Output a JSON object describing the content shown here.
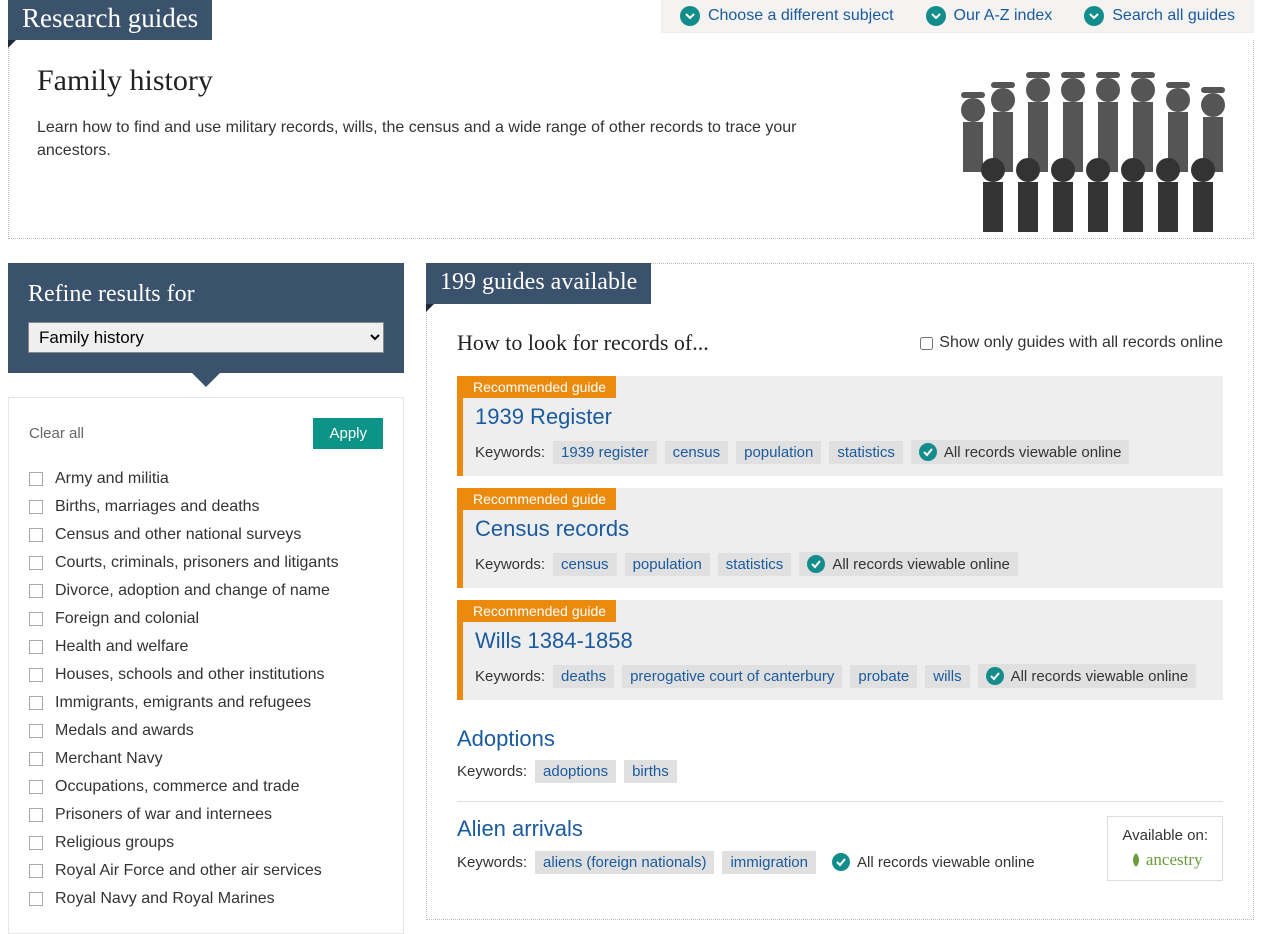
{
  "banner_title": "Research guides",
  "top_links": {
    "subject": "Choose a different subject",
    "az": "Our A-Z index",
    "search": "Search all guides"
  },
  "intro": {
    "title": "Family history",
    "desc": "Learn how to find and use military records, wills, the census and a wide range of other records to trace your ancestors."
  },
  "sidebar": {
    "heading": "Refine results for",
    "select_value": "Family history",
    "clear": "Clear all",
    "apply": "Apply",
    "filters": [
      "Army and militia",
      "Births, marriages and deaths",
      "Census and other national surveys",
      "Courts, criminals, prisoners and litigants",
      "Divorce, adoption and change of name",
      "Foreign and colonial",
      "Health and welfare",
      "Houses, schools and other institutions",
      "Immigrants, emigrants and refugees",
      "Medals and awards",
      "Merchant Navy",
      "Occupations, commerce and trade",
      "Prisoners of war and internees",
      "Religious groups",
      "Royal Air Force and other air services",
      "Royal Navy and Royal Marines"
    ]
  },
  "results": {
    "count_label": "199 guides available",
    "how_to": "How to look for records of...",
    "show_online": "Show only guides with all records online",
    "rec_label": "Recommended guide",
    "kw_label": "Keywords:",
    "online_label": "All records viewable online",
    "available_on": "Available on:",
    "ancestry": "ancestry",
    "cards": [
      {
        "title": "1939 Register",
        "keywords": [
          "1939 register",
          "census",
          "population",
          "statistics"
        ],
        "online": true
      },
      {
        "title": "Census records",
        "keywords": [
          "census",
          "population",
          "statistics"
        ],
        "online": true
      },
      {
        "title": "Wills 1384-1858",
        "keywords": [
          "deaths",
          "prerogative court of canterbury",
          "probate",
          "wills"
        ],
        "online": true
      }
    ],
    "items": [
      {
        "title": "Adoptions",
        "keywords": [
          "adoptions",
          "births"
        ],
        "online": false,
        "available": false
      },
      {
        "title": "Alien arrivals",
        "keywords": [
          "aliens (foreign nationals)",
          "immigration"
        ],
        "online": true,
        "available": true
      }
    ]
  }
}
